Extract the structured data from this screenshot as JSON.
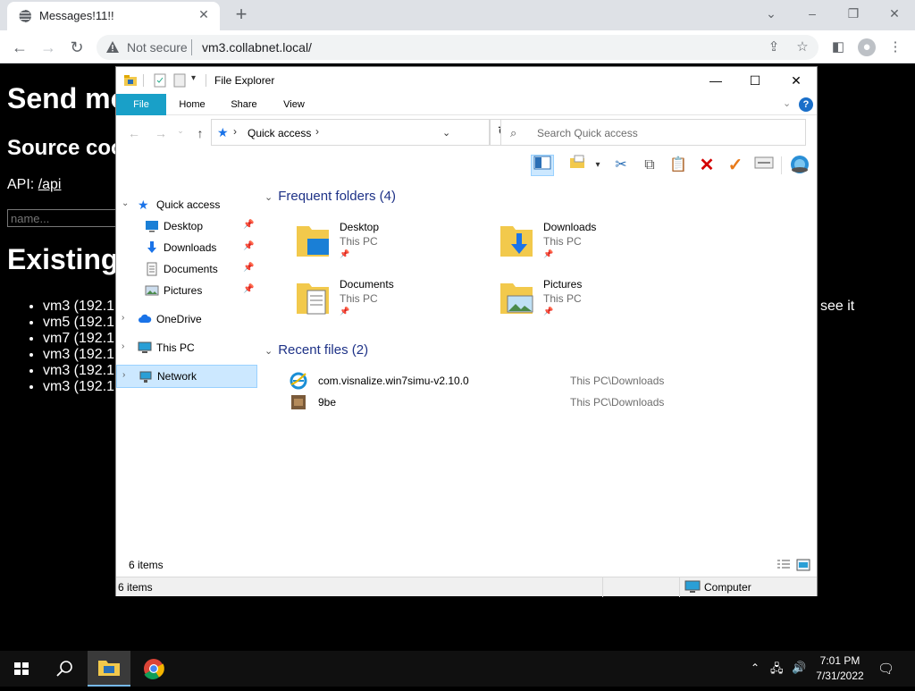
{
  "browser": {
    "tab_title": "Messages!11!!",
    "tab_close": "✕",
    "new_tab": "+",
    "security_label": "Not secure",
    "url": "vm3.collabnet.local/",
    "window_controls": [
      "⌄",
      "–",
      "❐",
      "✕"
    ]
  },
  "page": {
    "heading": "Send mo",
    "source_heading": "Source coo",
    "api_prefix": "API:",
    "api_link": "/api",
    "name_placeholder": "name...",
    "existing_heading": "Existing",
    "items": [
      "vm3 (192.1",
      "vm5 (192.1",
      "vm7 (192.1",
      "vm3 (192.1",
      "vm3 (192.1",
      "vm3 (192.1"
    ],
    "trailing_text": "see it"
  },
  "explorer": {
    "title": "File Explorer",
    "ribbon_tabs": [
      "File",
      "Home",
      "Share",
      "View"
    ],
    "address": "Quick access",
    "search_placeholder": "Search Quick access",
    "nav": [
      {
        "label": "Quick access",
        "icon": "star-icon",
        "pinned": false,
        "expand": "⌄"
      },
      {
        "label": "Desktop",
        "icon": "desktop-icon",
        "pinned": true
      },
      {
        "label": "Downloads",
        "icon": "download-icon",
        "pinned": true
      },
      {
        "label": "Documents",
        "icon": "documents-icon",
        "pinned": true
      },
      {
        "label": "Pictures",
        "icon": "pictures-icon",
        "pinned": true
      },
      {
        "label": "OneDrive",
        "icon": "cloud-icon",
        "expand": "›"
      },
      {
        "label": "This PC",
        "icon": "computer-icon",
        "expand": "›"
      },
      {
        "label": "Network",
        "icon": "network-icon",
        "expand": "›",
        "selected": true
      }
    ],
    "frequent_header": "Frequent folders (4)",
    "frequent": [
      {
        "name": "Desktop",
        "location": "This PC"
      },
      {
        "name": "Downloads",
        "location": "This PC"
      },
      {
        "name": "Documents",
        "location": "This PC"
      },
      {
        "name": "Pictures",
        "location": "This PC"
      }
    ],
    "recent_header": "Recent files (2)",
    "recent": [
      {
        "name": "com.visnalize.win7simu-v2.10.0",
        "location": "This PC\\Downloads",
        "icon": "ie-icon"
      },
      {
        "name": "9be",
        "location": "This PC\\Downloads",
        "icon": "image-file-icon"
      }
    ],
    "status_count": "6 items",
    "footer_count": "6 items",
    "footer_computer": "Computer"
  },
  "taskbar": {
    "time": "7:01 PM",
    "date": "7/31/2022"
  }
}
